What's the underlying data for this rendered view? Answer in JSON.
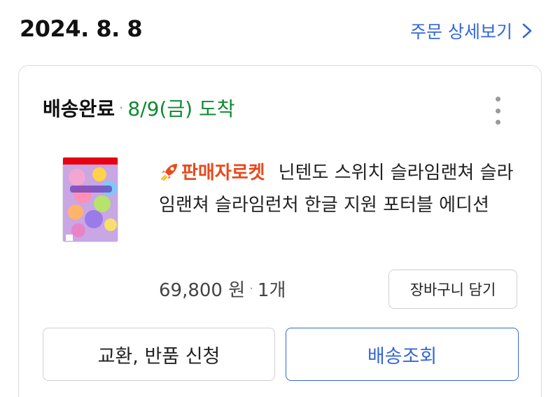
{
  "order": {
    "date": "2024. 8. 8",
    "detail_link_label": "주문 상세보기"
  },
  "status": {
    "title": "배송완료",
    "separator": "·",
    "arrival": "8/9(금) 도착",
    "arrival_color": "#0d8a2e"
  },
  "product": {
    "badge_label": "판매자로켓",
    "badge_icon": "rocket-icon",
    "badge_color": "#e8491d",
    "name": "닌텐도 스위치 슬라임랜쳐 슬라임랜쳐 슬라임런처 한글 지원 포터블 에디션",
    "price": "69,800 원",
    "quantity": "1개"
  },
  "buttons": {
    "add_to_cart": "장바구니 담기",
    "return_exchange": "교환, 반품 신청",
    "track_delivery": "배송조회"
  },
  "colors": {
    "accent": "#3468d6"
  }
}
